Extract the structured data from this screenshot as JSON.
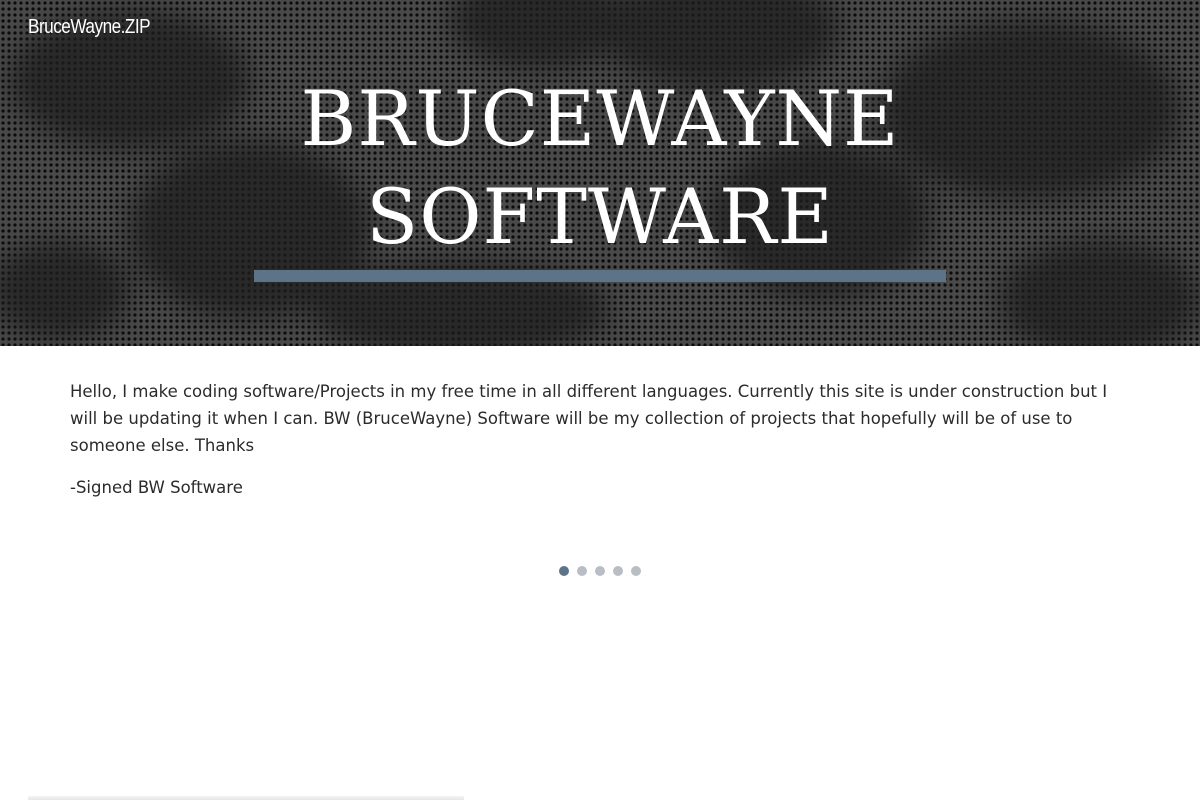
{
  "header": {
    "site_title": "BruceWayne.ZIP"
  },
  "hero": {
    "title_line1": "BRUCEWAYNE",
    "title_line2": "SOFTWARE",
    "accent_color": "#5d7488",
    "background_color": "#2a2a2a"
  },
  "main": {
    "intro_text": "Hello, I make coding software/Projects in my free time in all different languages. Currently this site is under construction but I will be updating it when I can. BW (BruceWayne) Software will be my collection of projects that hopefully will be of use to someone else. Thanks",
    "signature": "-Signed BW Software"
  },
  "slider": {
    "total_slides": 5,
    "active_slide": 1
  }
}
